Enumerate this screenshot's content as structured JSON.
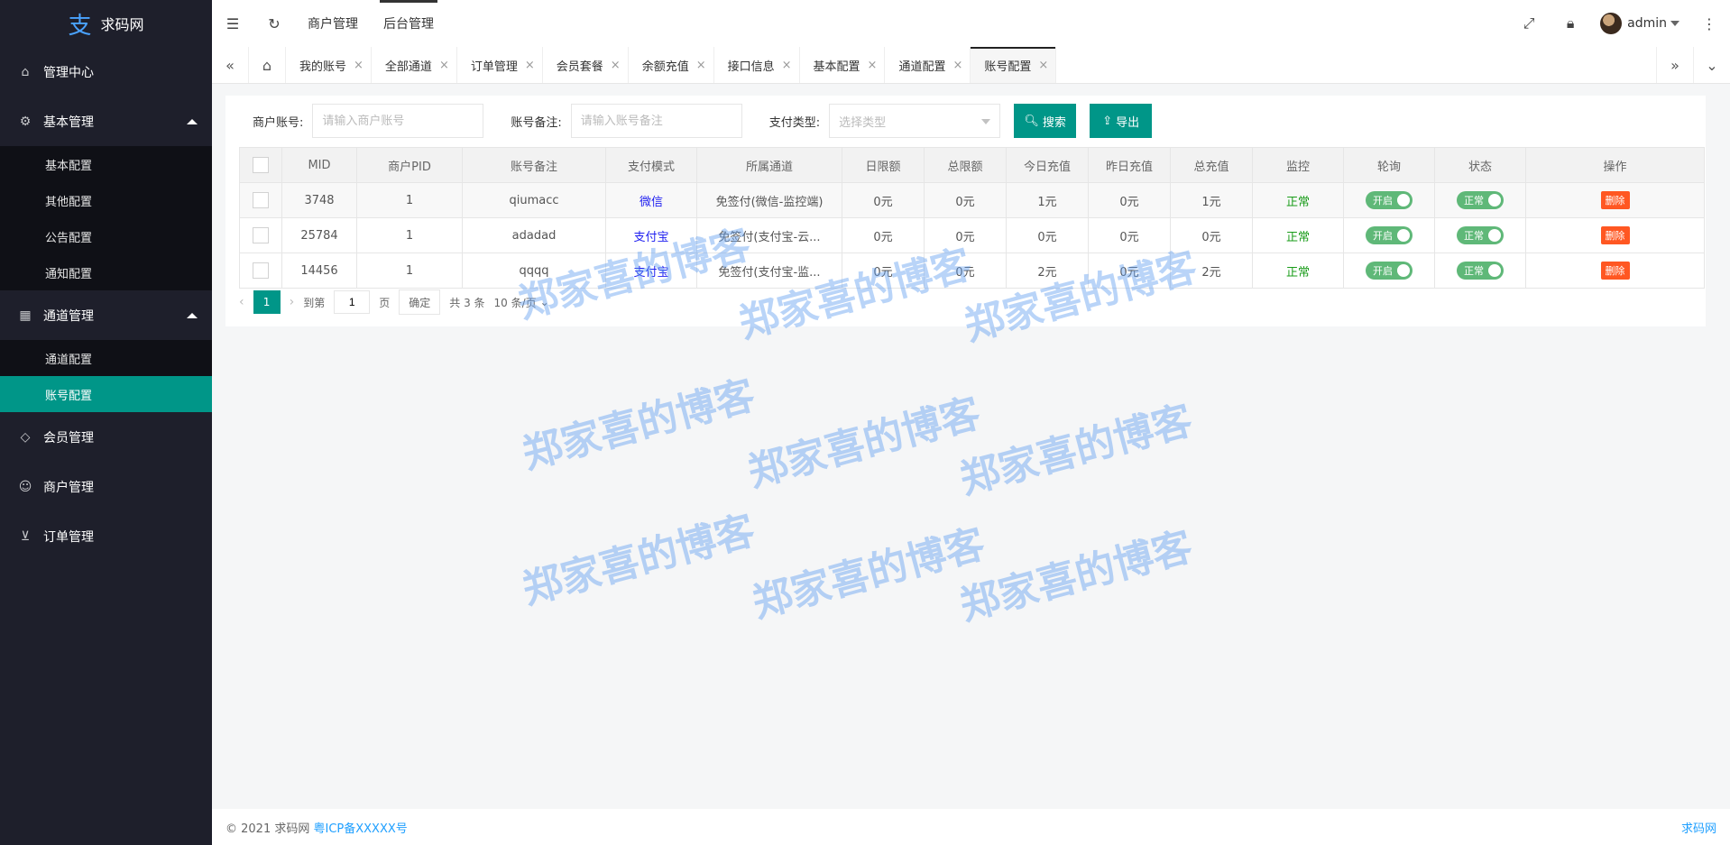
{
  "sidebar": {
    "logo_text": "求码网",
    "logo_mark": "支",
    "items": [
      {
        "label": "管理中心",
        "icon": "home-icon"
      },
      {
        "label": "基本管理",
        "icon": "gear-icon",
        "expanded": true,
        "children": [
          "基本配置",
          "其他配置",
          "公告配置",
          "通知配置"
        ]
      },
      {
        "label": "通道管理",
        "icon": "apps-icon",
        "expanded": true,
        "children": [
          "通道配置",
          "账号配置"
        ]
      },
      {
        "label": "会员管理",
        "icon": "diamond-icon"
      },
      {
        "label": "商户管理",
        "icon": "user-icon"
      },
      {
        "label": "订单管理",
        "icon": "cart-icon"
      }
    ],
    "active_child": "账号配置"
  },
  "header": {
    "links": [
      "商户管理",
      "后台管理"
    ],
    "active_link": "后台管理",
    "username": "admin"
  },
  "tabs": {
    "items": [
      "我的账号",
      "全部通道",
      "订单管理",
      "会员套餐",
      "余额充值",
      "接口信息",
      "基本配置",
      "通道配置",
      "账号配置"
    ],
    "active": "账号配置"
  },
  "search": {
    "merchant_label": "商户账号:",
    "merchant_placeholder": "请输入商户账号",
    "remark_label": "账号备注:",
    "remark_placeholder": "请输入账号备注",
    "paytype_label": "支付类型:",
    "paytype_placeholder": "选择类型",
    "search_button": "搜索",
    "export_button": "导出"
  },
  "table": {
    "headers": [
      "MID",
      "商户PID",
      "账号备注",
      "支付模式",
      "所属通道",
      "日限额",
      "总限额",
      "今日充值",
      "昨日充值",
      "总充值",
      "监控",
      "轮询",
      "状态",
      "操作"
    ],
    "rows": [
      {
        "mid": "3748",
        "pid": "1",
        "remark": "qiumacc",
        "mode": "微信",
        "channel": "免签付(微信-监控端)",
        "daily": "0元",
        "total_limit": "0元",
        "today": "1元",
        "yesterday": "0元",
        "total": "1元",
        "monitor": "正常",
        "poll": "开启",
        "status": "正常",
        "action": "删除"
      },
      {
        "mid": "25784",
        "pid": "1",
        "remark": "adadad",
        "mode": "支付宝",
        "channel": "免签付(支付宝-云...",
        "daily": "0元",
        "total_limit": "0元",
        "today": "0元",
        "yesterday": "0元",
        "total": "0元",
        "monitor": "正常",
        "poll": "开启",
        "status": "正常",
        "action": "删除"
      },
      {
        "mid": "14456",
        "pid": "1",
        "remark": "qqqq",
        "mode": "支付宝",
        "channel": "免签付(支付宝-监...",
        "daily": "0元",
        "total_limit": "0元",
        "today": "2元",
        "yesterday": "0元",
        "total": "2元",
        "monitor": "正常",
        "poll": "开启",
        "status": "正常",
        "action": "删除"
      }
    ]
  },
  "pager": {
    "current": "1",
    "goto_label": "到第",
    "goto_value": "1",
    "page_unit": "页",
    "confirm": "确定",
    "total": "共 3 条",
    "page_size": "10 条/页"
  },
  "footer": {
    "copyright": "© 2021 求码网",
    "icp": "粤ICP备XXXXX号",
    "right_text": "求码网"
  },
  "watermark": "郑家喜的博客",
  "colors": {
    "sidebar_bg": "#1e1f2b",
    "accent": "#009688",
    "switch_on": "#5FB878",
    "danger": "#FF5722",
    "link": "#1E1EF0",
    "ok": "#1a9c1a"
  }
}
